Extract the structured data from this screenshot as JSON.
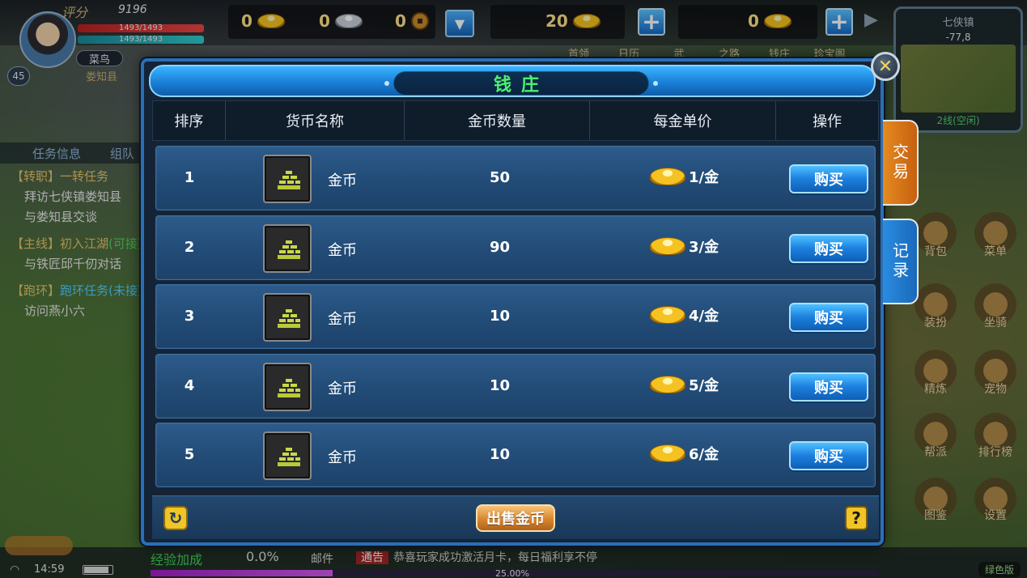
{
  "hud": {
    "score_label": "评分",
    "score_value": "9196",
    "hp": "1493/1493",
    "mp": "1493/1493",
    "rank": "菜鸟",
    "location": "娄知县",
    "level": "45",
    "gold_ingot": "0",
    "silver_ingot": "0",
    "copper": "0",
    "bound_gold": "20",
    "gold": "0",
    "menu_labels": [
      "首领",
      "日历",
      "武",
      "之路",
      "钱庄",
      "珍宝阁"
    ]
  },
  "minimap": {
    "title": "七侠镇",
    "coord": "-77,8",
    "line": "2线(空闲)"
  },
  "quests": {
    "tab_info": "任务信息",
    "tab_team": "组队",
    "items": [
      {
        "head": "【转职】一转任务",
        "lines": [
          "拜访七侠镇娄知县",
          "与娄知县交谈"
        ]
      },
      {
        "head": "【主线】初入江湖",
        "tag": "(可接)",
        "lines": [
          "与铁匠邱千仞对话"
        ]
      },
      {
        "head": "【跑环】",
        "tag": "跑环任务(未接)",
        "lines": [
          "访问燕小六"
        ]
      }
    ]
  },
  "side_icons": [
    "背包",
    "菜单",
    "装扮",
    "坐骑",
    "精炼",
    "宠物",
    "帮派",
    "排行榜",
    "图鉴",
    "设置"
  ],
  "bank": {
    "title": "钱庄",
    "close": "✕",
    "headers": [
      "排序",
      "货币名称",
      "金币数量",
      "每金单价",
      "操作"
    ],
    "rows": [
      {
        "idx": "1",
        "name": "金币",
        "amount": "50",
        "price": "1/金",
        "action": "购买"
      },
      {
        "idx": "2",
        "name": "金币",
        "amount": "90",
        "price": "3/金",
        "action": "购买"
      },
      {
        "idx": "3",
        "name": "金币",
        "amount": "10",
        "price": "4/金",
        "action": "购买"
      },
      {
        "idx": "4",
        "name": "金币",
        "amount": "10",
        "price": "5/金",
        "action": "购买"
      },
      {
        "idx": "5",
        "name": "金币",
        "amount": "10",
        "price": "6/金",
        "action": "购买"
      }
    ],
    "sell_label": "出售金币",
    "help": "?",
    "refresh": "↻",
    "tab_trade": "交易",
    "tab_record": "记录"
  },
  "bottom": {
    "exp_label": "经验加成",
    "exp_pct": "0.0%",
    "mail": "邮件",
    "ticker_badge": "通告",
    "ticker": "恭喜玩家成功激活月卡，每日福利享不停",
    "progress": 0.25,
    "progress_label": "25.00%",
    "time": "14:59",
    "version": "绿色版"
  },
  "colors": {
    "accent_blue": "#1a7fd8",
    "title_green": "#4ef071",
    "buy_blue": "#1b7fde",
    "sell_orange": "#d8852f",
    "trade_tab": "#e58a20"
  }
}
